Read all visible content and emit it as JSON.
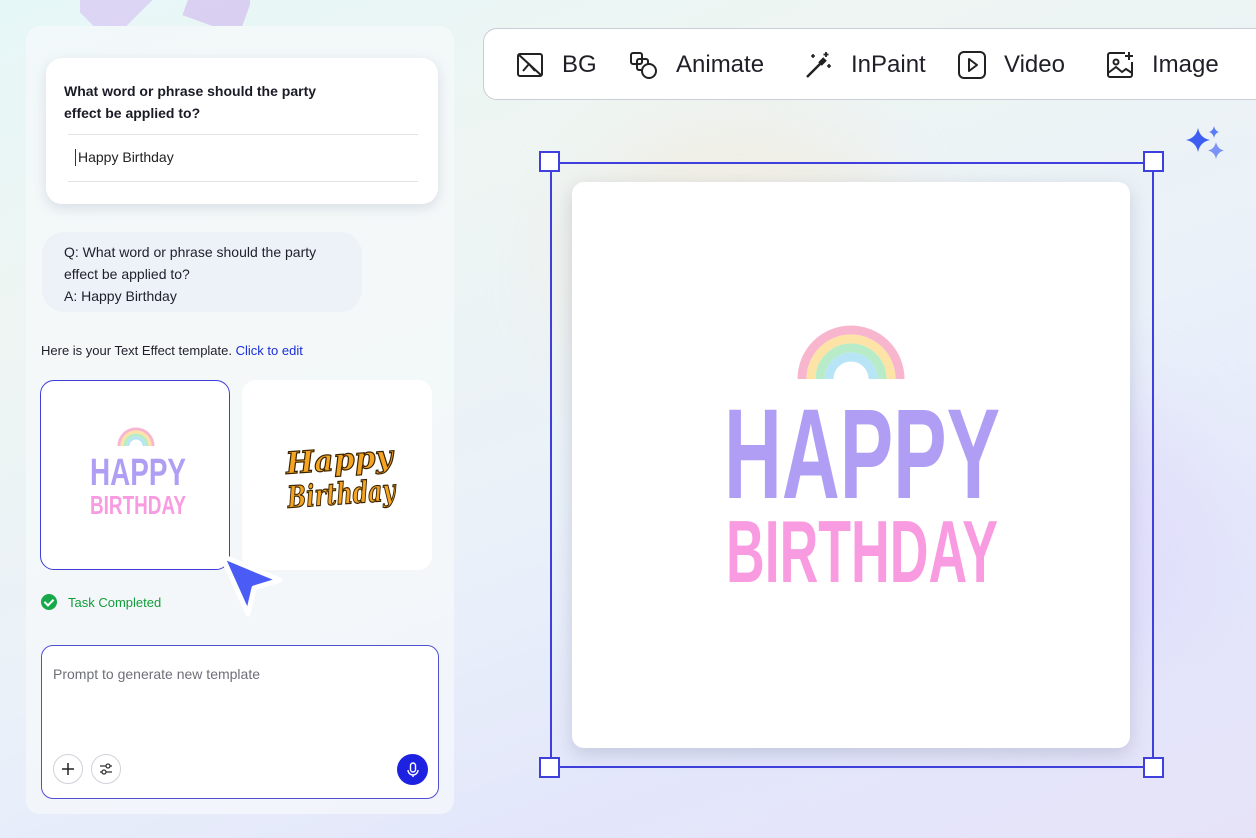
{
  "question_card": {
    "question": "What word or phrase should the party effect be applied to?",
    "input_value": "Happy Birthday"
  },
  "qa_bubble": {
    "question_line": "Q: What word or phrase should the party effect be applied to?",
    "answer_line": "A: Happy Birthday"
  },
  "template_note": {
    "text": "Here is your Text Effect template.",
    "link": "Click to edit"
  },
  "templates": [
    {
      "line1": "HAPPY",
      "line2": "BIRTHDAY",
      "style": "block-pastel",
      "selected": true
    },
    {
      "line1": "Happy",
      "line2": "Birthday",
      "style": "script-orange",
      "selected": false
    }
  ],
  "status": {
    "text": "Task Completed",
    "color": "#17a84a"
  },
  "prompt": {
    "placeholder": "Prompt to generate new template",
    "plus_icon": "plus-icon",
    "settings_icon": "sliders-icon",
    "mic_icon": "microphone-icon"
  },
  "toolbar": {
    "items": [
      {
        "label": "BG",
        "icon": "remove-bg-icon"
      },
      {
        "label": "Animate",
        "icon": "animate-icon"
      },
      {
        "label": "InPaint",
        "icon": "magic-wand-icon"
      },
      {
        "label": "Video",
        "icon": "video-play-icon"
      },
      {
        "label": "Image",
        "icon": "image-plus-icon"
      }
    ]
  },
  "canvas": {
    "line1": "HAPPY",
    "line2": "BIRTHDAY",
    "line1_color": "#b09ef5",
    "line2_color": "#f89be0"
  },
  "colors": {
    "accent": "#3e3fdc",
    "mic": "#1c22e0",
    "link": "#1a2ed8",
    "script_text": "#f5a422"
  }
}
